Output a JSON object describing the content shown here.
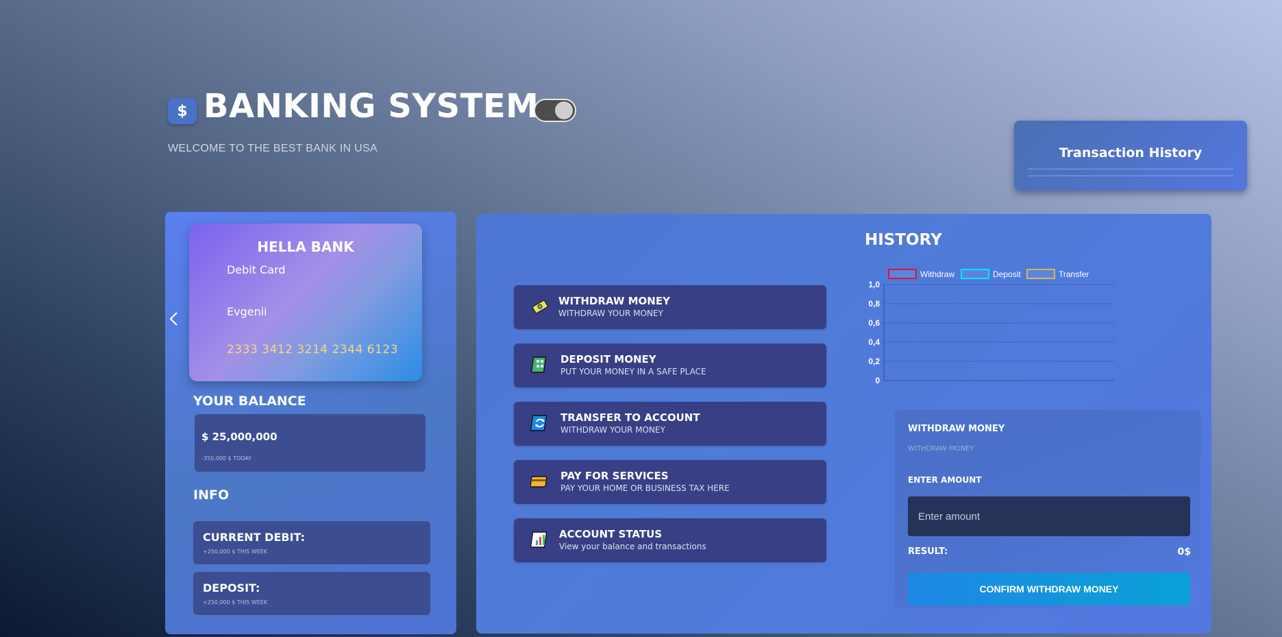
{
  "header": {
    "logo_symbol": "$",
    "title": "BANKING SYSTEM",
    "subtitle": "WELCOME TO THE BEST BANK IN USA",
    "theme_toggle_on": true
  },
  "transaction_history": {
    "title": "Transaction History"
  },
  "card": {
    "bank": "HELLA BANK",
    "type": "Debit Card",
    "holder": "Evgenii",
    "number": "2333 3412 3214 2344 6123"
  },
  "balance": {
    "title": "YOUR BALANCE",
    "amount": "$ 25,000,000",
    "change": "-350,000 $ TODAY"
  },
  "info": {
    "title": "INFO",
    "items": [
      {
        "label": "CURRENT DEBIT:",
        "sub": "+250,000 $ THIS WEEK"
      },
      {
        "label": "DEPOSIT:",
        "sub": "+250,000 $ THIS WEEK"
      }
    ]
  },
  "actions": [
    {
      "icon": "money-icon",
      "title": "WITHDRAW MONEY",
      "subtitle": "WITHDRAW YOUR MONEY"
    },
    {
      "icon": "bank-building-icon",
      "title": "DEPOSIT MONEY",
      "subtitle": "PUT YOUR MONEY IN A SAFE PLACE"
    },
    {
      "icon": "transfer-icon",
      "title": "TRANSFER TO ACCOUNT",
      "subtitle": "WITHDRAW YOUR MONEY"
    },
    {
      "icon": "credit-card-icon",
      "title": "PAY FOR SERVICES",
      "subtitle": "PAY YOUR HOME OR BUSINESS TAX HERE"
    },
    {
      "icon": "chart-icon",
      "title": "ACCOUNT STATUS",
      "subtitle": "View your balance and transactions"
    }
  ],
  "history": {
    "title": "HISTORY"
  },
  "chart_data": {
    "type": "line",
    "title": "",
    "xlabel": "",
    "ylabel": "",
    "ylim": [
      0,
      1
    ],
    "y_ticks": [
      "0",
      "0,2",
      "0,4",
      "0,6",
      "0,8",
      "1,0"
    ],
    "categories": [],
    "legend_position": "top",
    "series": [
      {
        "name": "Withdraw",
        "color": "#dc143c",
        "values": []
      },
      {
        "name": "Deposit",
        "color": "#00e5ff",
        "values": []
      },
      {
        "name": "Transfer",
        "color": "#d4b94a",
        "values": []
      }
    ]
  },
  "form": {
    "title": "WITHDRAW MONEY",
    "subtitle": "WITHDRAW MONEY",
    "amount_label": "ENTER AMOUNT",
    "amount_placeholder": "Enter amount",
    "amount_value": "",
    "result_label": "RESULT:",
    "result_value": "0$",
    "confirm_label": "CONFIRM WITHDRAW MONEY"
  }
}
